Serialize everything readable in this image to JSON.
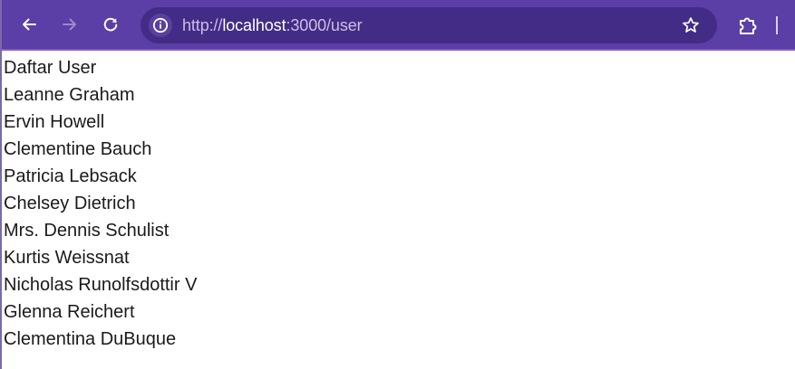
{
  "browser": {
    "url_scheme": "http://",
    "url_host": "localhost",
    "url_rest": ":3000/user",
    "toolbar_color": "#5b3ea6",
    "omnibox_color": "#432c86",
    "icons": {
      "back": "arrow-left-icon",
      "forward": "arrow-right-icon",
      "reload": "reload-icon",
      "site_info": "info-icon",
      "bookmark": "star-icon",
      "extensions": "puzzle-icon"
    }
  },
  "page": {
    "heading": "Daftar User",
    "users": [
      "Leanne Graham",
      "Ervin Howell",
      "Clementine Bauch",
      "Patricia Lebsack",
      "Chelsey Dietrich",
      "Mrs. Dennis Schulist",
      "Kurtis Weissnat",
      "Nicholas Runolfsdottir V",
      "Glenna Reichert",
      "Clementina DuBuque"
    ]
  }
}
